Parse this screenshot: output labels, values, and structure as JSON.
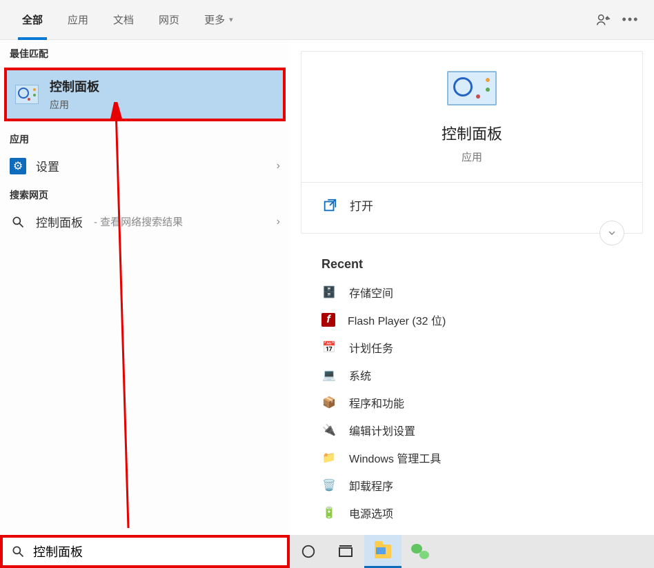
{
  "tabs": {
    "all": "全部",
    "apps": "应用",
    "docs": "文档",
    "web": "网页",
    "more": "更多"
  },
  "sections": {
    "best_match": "最佳匹配",
    "apps": "应用",
    "search_web": "搜索网页"
  },
  "best_match": {
    "title": "控制面板",
    "subtitle": "应用"
  },
  "apps_list": {
    "settings": "设置"
  },
  "web_list": {
    "query": "控制面板",
    "suffix": " - 查看网络搜索结果"
  },
  "preview": {
    "title": "控制面板",
    "subtitle": "应用",
    "open": "打开",
    "recent_heading": "Recent",
    "recent": [
      "存储空间",
      "Flash Player (32 位)",
      "计划任务",
      "系统",
      "程序和功能",
      "编辑计划设置",
      "Windows 管理工具",
      "卸载程序",
      "电源选项"
    ]
  },
  "search": {
    "value": "控制面板"
  }
}
